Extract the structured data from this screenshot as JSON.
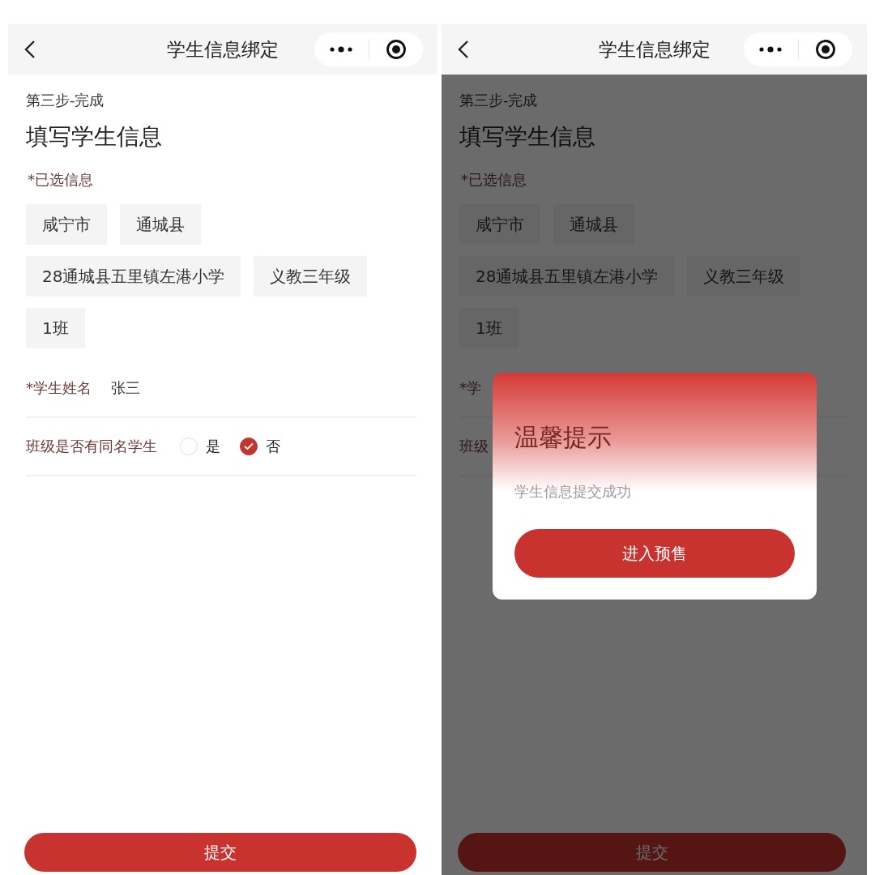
{
  "screens": [
    {
      "nav": {
        "title": "学生信息绑定"
      },
      "step": "第三步-完成",
      "heading": "填写学生信息",
      "selected_label": "*已选信息",
      "tags": [
        "咸宁市",
        "通城县",
        "28通城县五里镇左港小学",
        "义教三年级",
        "1班"
      ],
      "fields": [
        {
          "kind": "text",
          "label": "*学生姓名",
          "value": "张三"
        },
        {
          "kind": "radio",
          "label": "班级是否有同名学生",
          "options": [
            {
              "label": "是",
              "selected": false
            },
            {
              "label": "否",
              "selected": true
            }
          ]
        }
      ],
      "submit": "提交"
    },
    {
      "nav": {
        "title": "学生信息绑定"
      },
      "step": "第三步-完成",
      "heading": "填写学生信息",
      "selected_label": "*已选信息",
      "tags": [
        "咸宁市",
        "通城县",
        "28通城县五里镇左港小学",
        "义教三年级",
        "1班"
      ],
      "fields": [
        {
          "kind": "text",
          "label": "*学"
        },
        {
          "kind": "label",
          "label": "班级"
        }
      ],
      "submit": "提交",
      "dialog": {
        "title": "温馨提示",
        "message": "学生信息提交成功",
        "button": "进入预售"
      }
    }
  ]
}
